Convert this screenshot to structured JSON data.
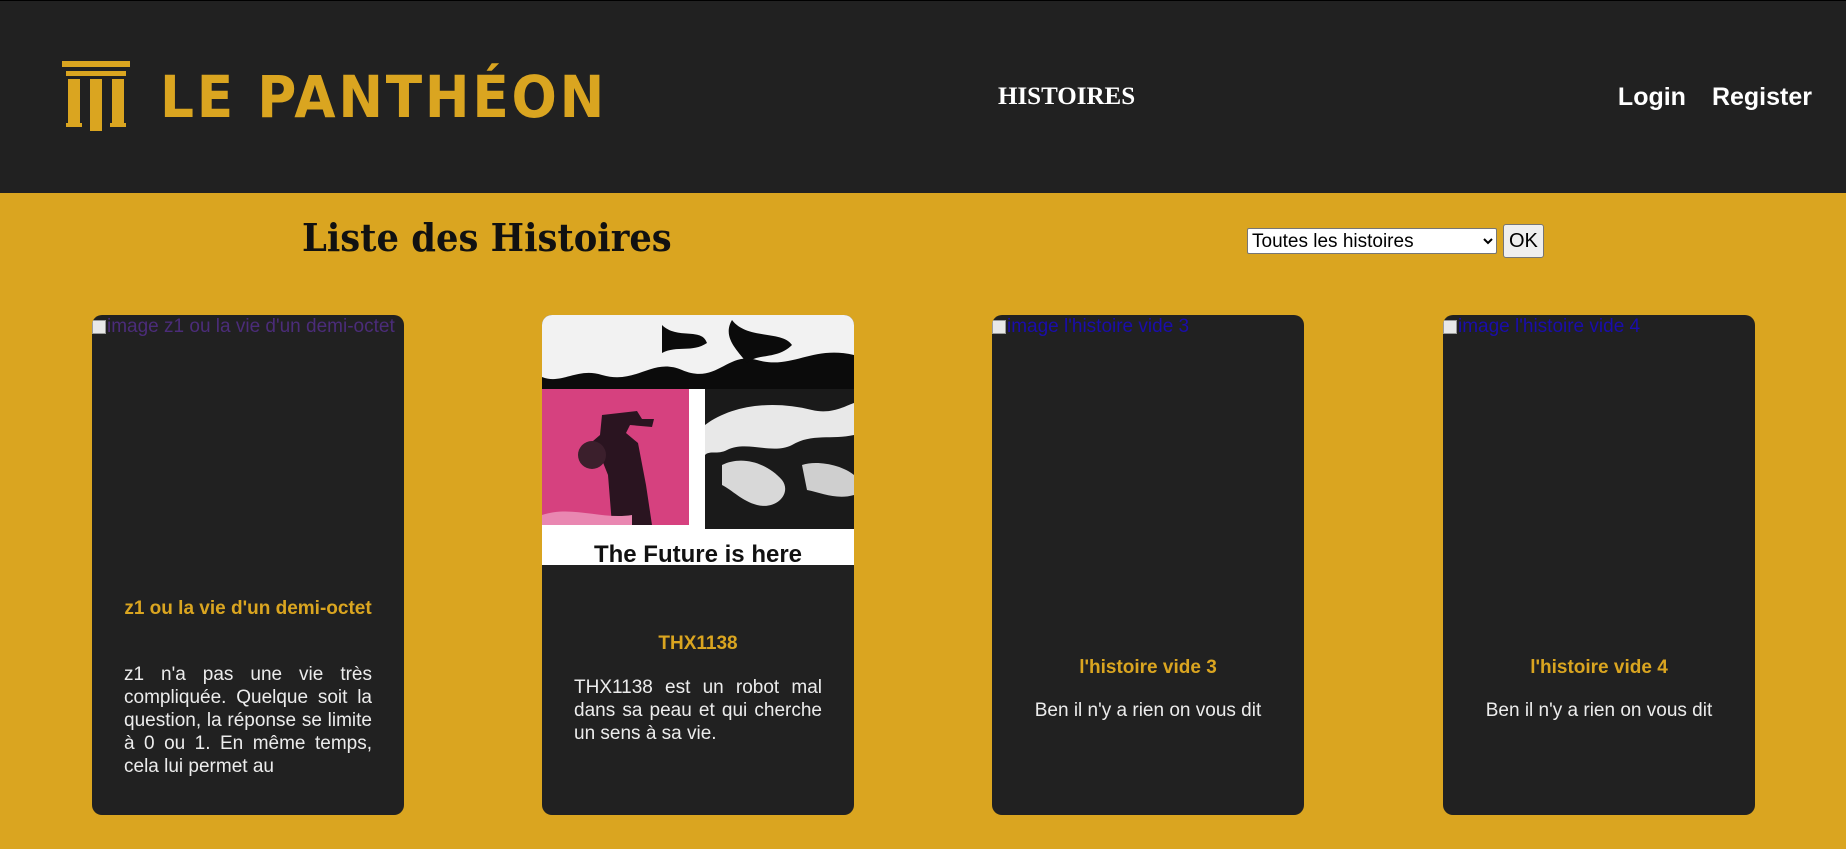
{
  "header": {
    "logo_text": "LE PANTHÉON",
    "nav_center": "HISTOIRES",
    "login": "Login",
    "register": "Register"
  },
  "main": {
    "title": "Liste des Histoires",
    "filter": {
      "selected": "Toutes les histoires",
      "button": "OK"
    },
    "stories": [
      {
        "image_alt": "image z1 ou la vie d'un demi-octet",
        "title": "z1 ou la vie d'un demi-octet",
        "description": "z1 n'a pas une vie très compliquée. Quelque soit la question, la réponse se limite à 0 ou 1. En même temps, cela lui permet au"
      },
      {
        "image_caption": "The Future is here",
        "title": "THX1138",
        "description": "THX1138 est un robot mal dans sa peau et qui cherche un sens à sa vie."
      },
      {
        "image_alt": "image l'histoire vide 3",
        "title": "l'histoire vide 3",
        "description": "Ben il n'y a rien on vous dit"
      },
      {
        "image_alt": "image l'histoire vide 4",
        "title": "l'histoire vide 4",
        "description": "Ben il n'y a rien on vous dit"
      }
    ]
  },
  "colors": {
    "page_background": "#DAA520",
    "header_background": "#212121",
    "card_background": "#212121",
    "accent": "#DAA520",
    "cover_pink": "#D6417F"
  }
}
